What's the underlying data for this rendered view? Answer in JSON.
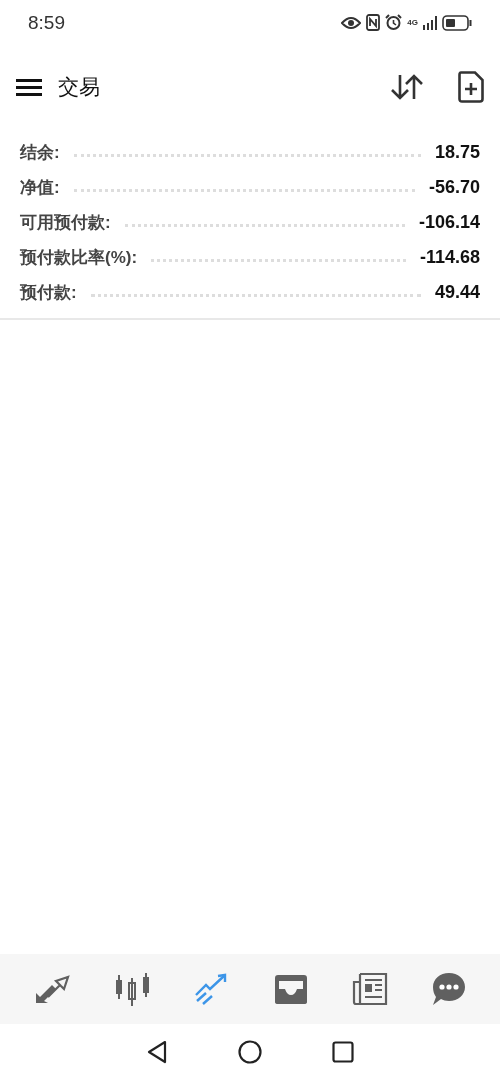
{
  "status_bar": {
    "time": "8:59",
    "network": "4G"
  },
  "header": {
    "title": "交易"
  },
  "summary": [
    {
      "label": "结余:",
      "value": "18.75"
    },
    {
      "label": "净值:",
      "value": "-56.70"
    },
    {
      "label": "可用预付款:",
      "value": "-106.14"
    },
    {
      "label": "预付款比率(%):",
      "value": "-114.68"
    },
    {
      "label": "预付款:",
      "value": "49.44"
    }
  ],
  "nav_tabs": [
    {
      "kind": "quotes",
      "selected": false
    },
    {
      "kind": "chart",
      "selected": false
    },
    {
      "kind": "trade",
      "selected": true
    },
    {
      "kind": "history",
      "selected": false
    },
    {
      "kind": "news",
      "selected": false
    },
    {
      "kind": "chat",
      "selected": false
    }
  ]
}
